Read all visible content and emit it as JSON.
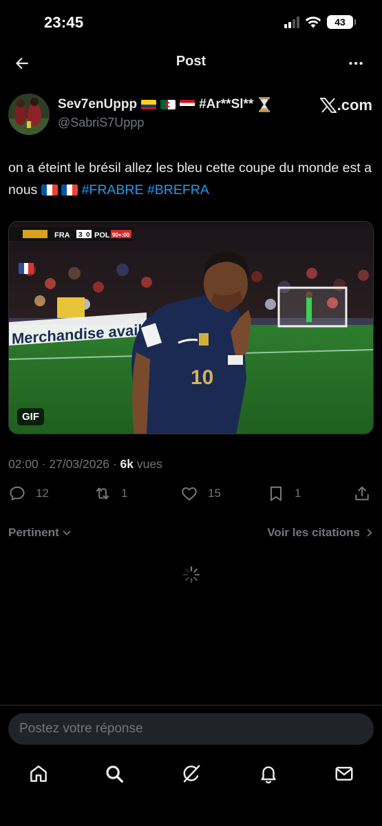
{
  "status_bar": {
    "time": "23:45",
    "battery": "43"
  },
  "header": {
    "title": "Post"
  },
  "author": {
    "display_name": "Sev7enUppp",
    "name_suffix": "#Ar**Sl**",
    "handle": "@SabriS7Uppp",
    "badge_text": ".com"
  },
  "post": {
    "text_main": "on a éteint le brésil allez les bleu cette coupe du monde est a nous",
    "hashtags": [
      "#FRABRE",
      "#BREFRA"
    ],
    "media_badge": "GIF",
    "scorebug": {
      "team1": "FRA",
      "score1": "3",
      "score2": "0",
      "team2": "POL",
      "clock": "90+:00"
    },
    "board_text": "Merchandise availa",
    "shirt_number": "10"
  },
  "meta": {
    "time": "02:00",
    "date": "27/03/2026",
    "views_count": "6k",
    "views_label": "vues"
  },
  "actions": {
    "replies": "12",
    "reposts": "1",
    "likes": "15",
    "bookmarks": "1"
  },
  "sort": {
    "left_label": "Pertinent",
    "right_label": "Voir les citations"
  },
  "reply": {
    "placeholder": "Postez votre réponse"
  },
  "colors": {
    "background": "#000000",
    "text": "#e7e9ea",
    "muted": "#71767b",
    "accent": "#1d9bf0",
    "reply_bg": "#202327"
  },
  "icons": {
    "back": "arrow-left-icon",
    "more": "more-horizontal-icon",
    "reply": "comment-icon",
    "repost": "repost-icon",
    "like": "heart-icon",
    "bookmark": "bookmark-icon",
    "share": "share-icon",
    "home": "home-icon",
    "search": "search-icon",
    "grok": "grok-icon",
    "notifications": "bell-icon",
    "messages": "mail-icon"
  }
}
